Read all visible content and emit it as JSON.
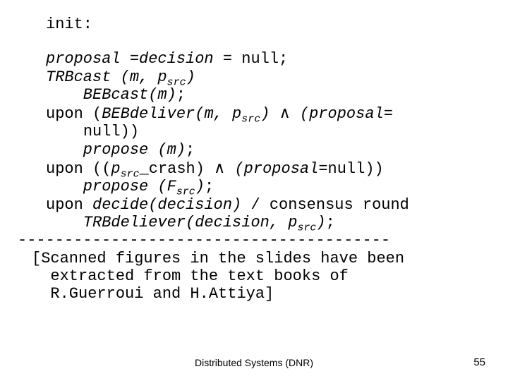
{
  "code": {
    "init": "init:",
    "l1_a": "proposal =decision",
    "l1_b": " = null;",
    "l2_a": "TRBcast (m, p",
    "l2_sub": "src",
    "l2_b": ")",
    "l3_a": "    BEBcast(m)",
    "l3_b": ";",
    "l4_a": "upon (",
    "l4_b": "BEBdeliver(m, p",
    "l4_sub": "src",
    "l4_c": ")",
    "l4_d": " ",
    "wedge": "∧",
    "l4_e": " (proposal",
    "l4_f": "=",
    "l5": "null))",
    "l6_a": "    propose (m)",
    "l6_b": ";",
    "l7_a": "upon ((",
    "l7_b": "p",
    "l7_sub": "src",
    "l7_c": "_crash) ",
    "l7_d": " (proposal",
    "l7_e": "=null))",
    "l8_a": "    propose (F",
    "l8_sub": "src",
    "l8_b": ")",
    "l8_c": ";",
    "l9_a": "upon ",
    "l9_b": "decide(decision)",
    "l9_c": " / consensus round",
    "l10_a": "    TRBdeliever(decision, p",
    "l10_sub": "src",
    "l10_b": ")",
    "l10_c": ";",
    "dashes": "----------------------------------------",
    "note1": "[Scanned figures in the slides have been",
    "note2": "  extracted from the text books of",
    "note3": "  R.Guerroui and H.Attiya]"
  },
  "footer": {
    "center": "Distributed Systems (DNR)",
    "right": "55"
  }
}
